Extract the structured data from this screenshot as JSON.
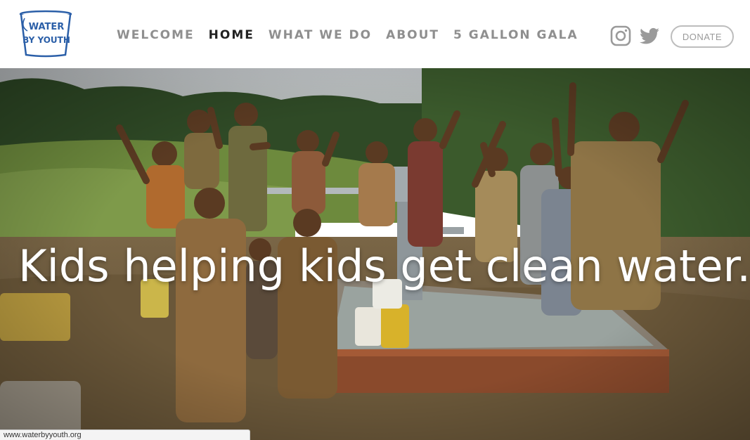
{
  "header": {
    "logo": {
      "line1": "WATER",
      "line2": "BY YOUTH",
      "icon": "bucket-logo",
      "color": "#2b5fa8"
    },
    "nav": [
      {
        "label": "WELCOME",
        "active": false
      },
      {
        "label": "HOME",
        "active": true
      },
      {
        "label": "WHAT WE DO",
        "active": false
      },
      {
        "label": "ABOUT",
        "active": false
      },
      {
        "label": "5 GALLON GALA",
        "active": false
      }
    ],
    "social": [
      {
        "icon": "instagram-icon"
      },
      {
        "icon": "twitter-icon"
      }
    ],
    "donate_label": "DONATE"
  },
  "hero": {
    "headline": "Kids helping kids get clean water.",
    "image": "children-at-water-pump-photo"
  },
  "status_bar": {
    "url": "www.waterbyyouth.org"
  },
  "colors": {
    "nav_inactive": "#8f8f8f",
    "nav_active": "#222222",
    "logo_blue": "#2b5fa8",
    "headline": "#ffffff"
  }
}
